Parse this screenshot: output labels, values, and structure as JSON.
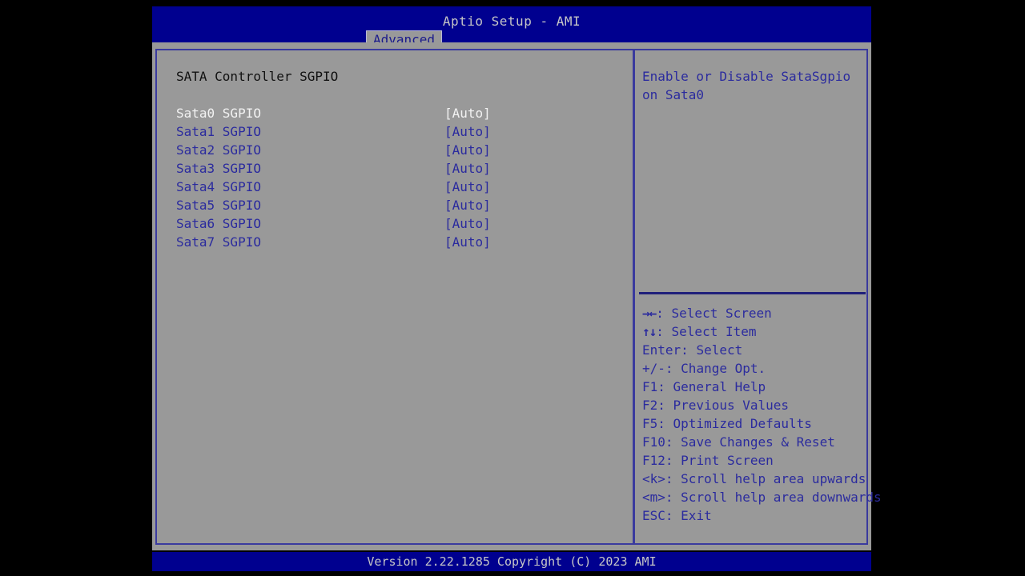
{
  "header": {
    "title": "Aptio Setup - AMI",
    "active_tab": "Advanced",
    "tabs": [
      "Advanced"
    ]
  },
  "main": {
    "section_title": "SATA Controller SGPIO",
    "rows": [
      {
        "label": "Sata0 SGPIO",
        "value": "[Auto]",
        "selected": true
      },
      {
        "label": "Sata1 SGPIO",
        "value": "[Auto]",
        "selected": false
      },
      {
        "label": "Sata2 SGPIO",
        "value": "[Auto]",
        "selected": false
      },
      {
        "label": "Sata3 SGPIO",
        "value": "[Auto]",
        "selected": false
      },
      {
        "label": "Sata4 SGPIO",
        "value": "[Auto]",
        "selected": false
      },
      {
        "label": "Sata5 SGPIO",
        "value": "[Auto]",
        "selected": false
      },
      {
        "label": "Sata6 SGPIO",
        "value": "[Auto]",
        "selected": false
      },
      {
        "label": "Sata7 SGPIO",
        "value": "[Auto]",
        "selected": false
      }
    ]
  },
  "help": {
    "description": "Enable or Disable SataSgpio on Sata0",
    "legend": [
      {
        "keys": "→←",
        "text": ": Select Screen",
        "glyph": true
      },
      {
        "keys": "↑↓",
        "text": ": Select Item",
        "glyph": true
      },
      {
        "keys": "Enter",
        "text": ": Select",
        "glyph": false
      },
      {
        "keys": "+/-",
        "text": ": Change Opt.",
        "glyph": false
      },
      {
        "keys": "F1",
        "text": ": General Help",
        "glyph": false
      },
      {
        "keys": "F2",
        "text": ": Previous Values",
        "glyph": false
      },
      {
        "keys": "F5",
        "text": ": Optimized Defaults",
        "glyph": false
      },
      {
        "keys": "F10",
        "text": ": Save Changes & Reset",
        "glyph": false
      },
      {
        "keys": "F12",
        "text": ": Print Screen",
        "glyph": false
      },
      {
        "keys": "<k>",
        "text": ": Scroll help area upwards",
        "glyph": false
      },
      {
        "keys": "<m>",
        "text": ": Scroll help area downwards",
        "glyph": false
      },
      {
        "keys": "ESC",
        "text": ": Exit",
        "glyph": false
      }
    ]
  },
  "footer": {
    "version_text": "Version 2.22.1285 Copyright (C) 2023 AMI"
  },
  "colors": {
    "bar_blue": "#00008f",
    "panel_gray": "#999999",
    "text_blue": "#2b2b9e",
    "text_selected": "#f2f2f2",
    "border_blue": "#3a3a9e",
    "title_gray": "#c6c6c6"
  }
}
